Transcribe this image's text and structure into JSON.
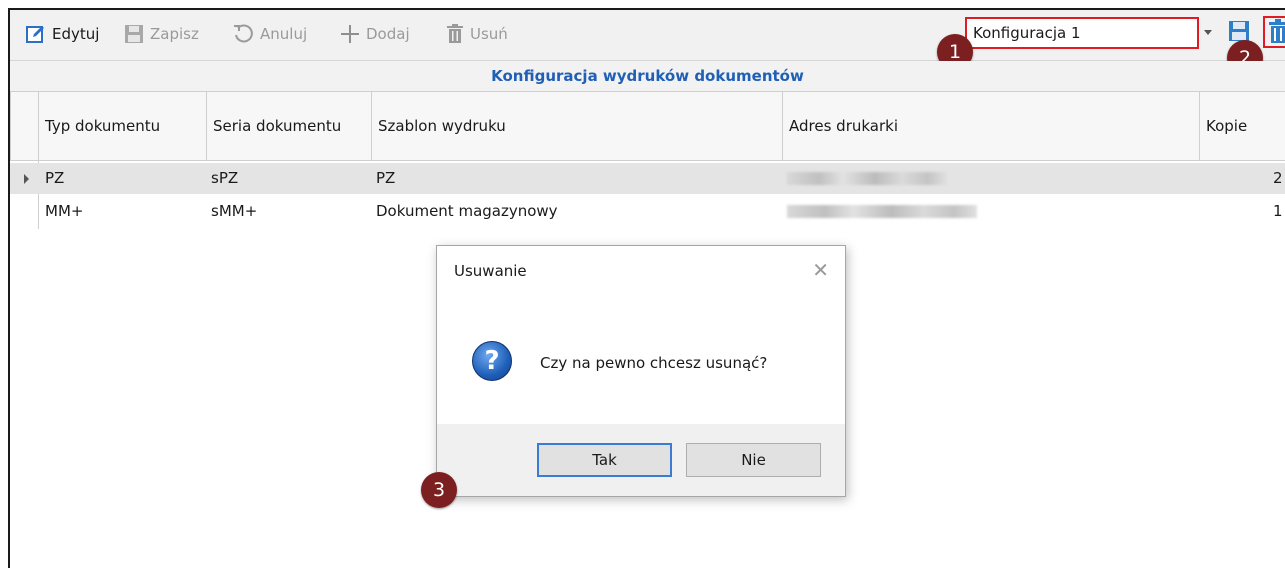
{
  "toolbar": {
    "edit_label": "Edytuj",
    "save_label": "Zapisz",
    "cancel_label": "Anuluj",
    "add_label": "Dodaj",
    "delete_label": "Usuń",
    "config_value": "Konfiguracja 1"
  },
  "markers": [
    "1",
    "2",
    "3"
  ],
  "grid": {
    "title": "Konfiguracja wydruków dokumentów",
    "columns": [
      "Typ dokumentu",
      "Seria dokumentu",
      "Szablon wydruku",
      "Adres drukarki",
      "Kopie"
    ],
    "rows": [
      {
        "typ": "PZ",
        "seria": "sPZ",
        "szablon": "PZ",
        "kopie": "2"
      },
      {
        "typ": "MM+",
        "seria": "sMM+",
        "szablon": "Dokument magazynowy",
        "kopie": "1"
      }
    ]
  },
  "dialog": {
    "title": "Usuwanie",
    "message": "Czy na pewno chcesz usunąć?",
    "yes_label": "Tak",
    "no_label": "Nie"
  },
  "colors": {
    "accent_blue": "#1f5fb5",
    "highlight_red": "#e01b24",
    "marker": "#7b1f20"
  }
}
